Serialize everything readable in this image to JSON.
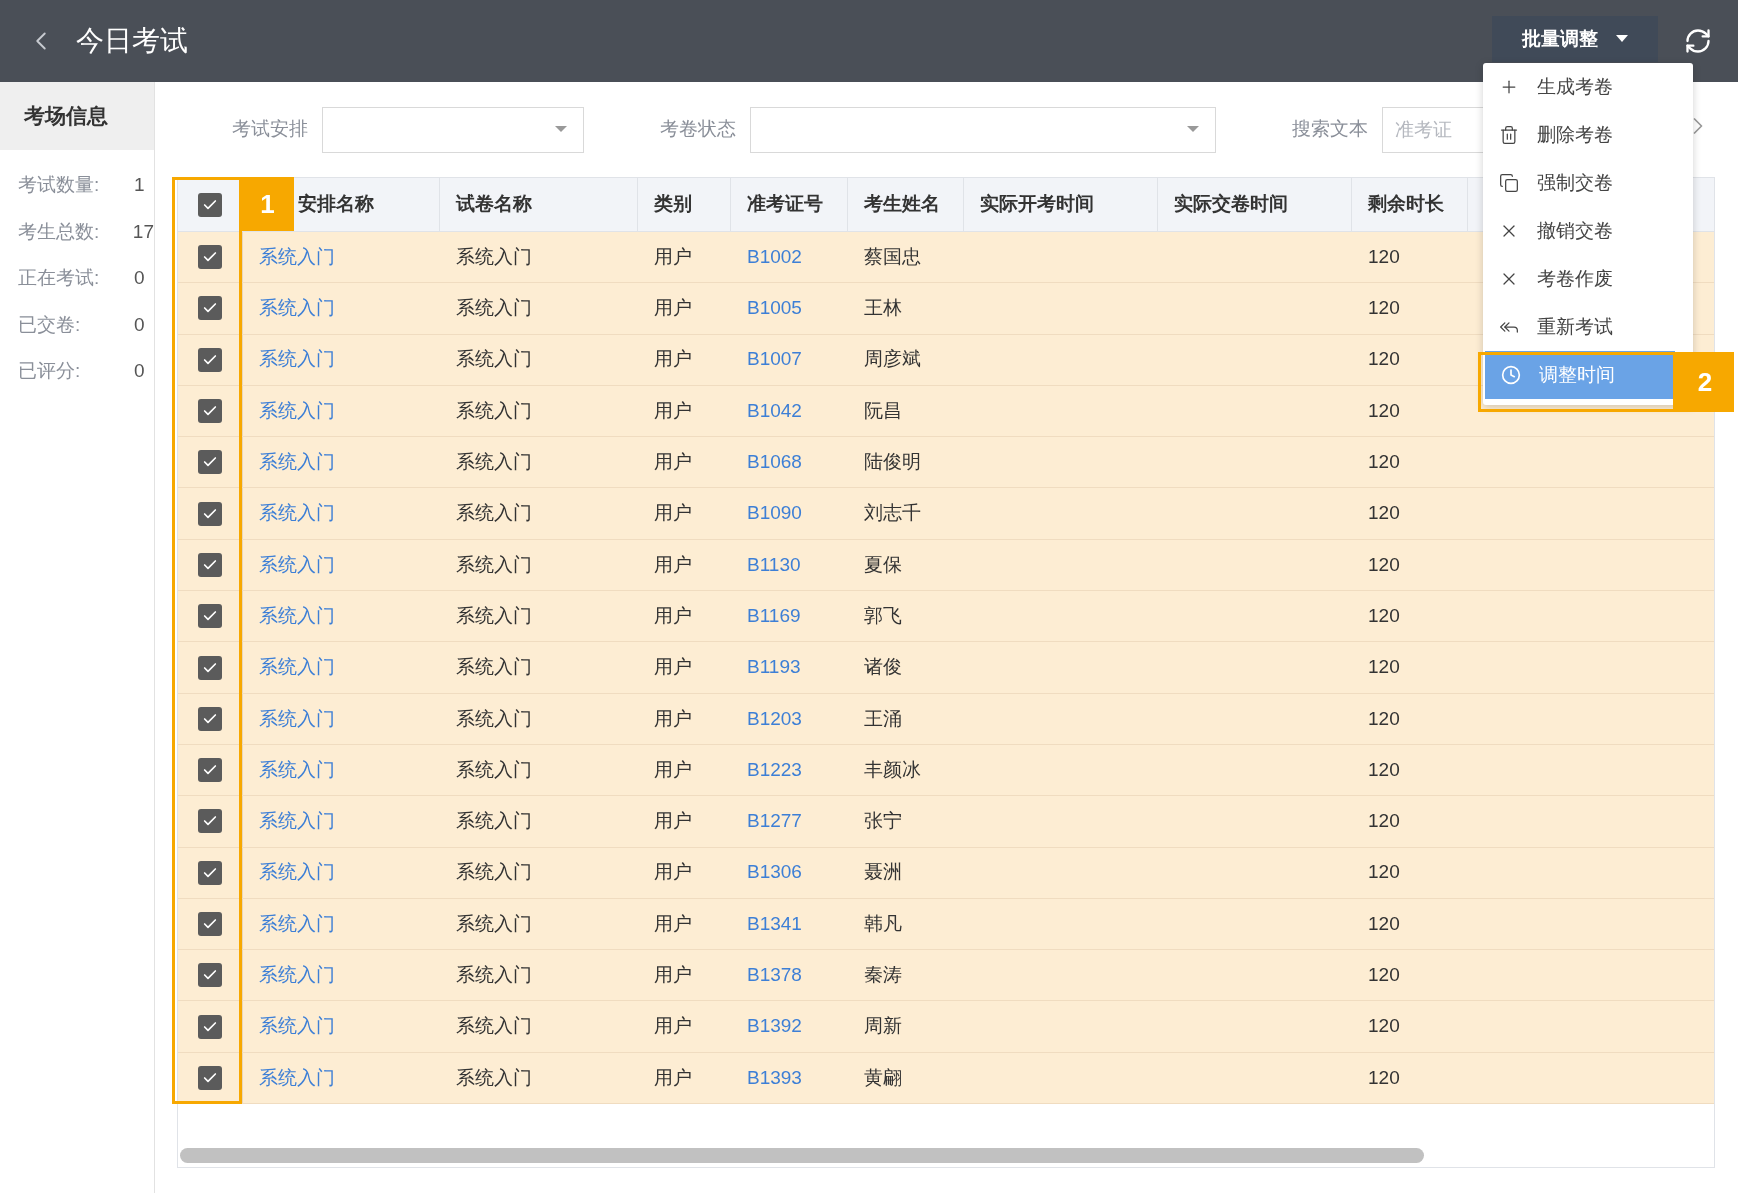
{
  "header": {
    "title": "今日考试",
    "batch_button": "批量调整"
  },
  "sidebar": {
    "title": "考场信息",
    "stats": [
      {
        "label": "考试数量:",
        "value": "1"
      },
      {
        "label": "考生总数:",
        "value": "17"
      },
      {
        "label": "正在考试:",
        "value": "0"
      },
      {
        "label": "已交卷:",
        "value": "0"
      },
      {
        "label": "已评分:",
        "value": "0"
      }
    ]
  },
  "filters": [
    {
      "kind": "select",
      "label": "考试安排"
    },
    {
      "kind": "select",
      "label": "考卷状态"
    },
    {
      "kind": "text",
      "label": "搜索文本",
      "placeholder": "准考证"
    }
  ],
  "table": {
    "select_all_checked": true,
    "columns": [
      "安排名称",
      "试卷名称",
      "类别",
      "准考证号",
      "考生姓名",
      "实际开考时间",
      "实际交卷时间",
      "剩余时长"
    ],
    "rows": [
      {
        "checked": true,
        "arrangement": "系统入门",
        "paper": "系统入门",
        "category": "用户",
        "ticket": "B1002",
        "name": "蔡国忠",
        "remaining": "120"
      },
      {
        "checked": true,
        "arrangement": "系统入门",
        "paper": "系统入门",
        "category": "用户",
        "ticket": "B1005",
        "name": "王林",
        "remaining": "120"
      },
      {
        "checked": true,
        "arrangement": "系统入门",
        "paper": "系统入门",
        "category": "用户",
        "ticket": "B1007",
        "name": "周彦斌",
        "remaining": "120"
      },
      {
        "checked": true,
        "arrangement": "系统入门",
        "paper": "系统入门",
        "category": "用户",
        "ticket": "B1042",
        "name": "阮昌",
        "remaining": "120"
      },
      {
        "checked": true,
        "arrangement": "系统入门",
        "paper": "系统入门",
        "category": "用户",
        "ticket": "B1068",
        "name": "陆俊明",
        "remaining": "120"
      },
      {
        "checked": true,
        "arrangement": "系统入门",
        "paper": "系统入门",
        "category": "用户",
        "ticket": "B1090",
        "name": "刘志千",
        "remaining": "120"
      },
      {
        "checked": true,
        "arrangement": "系统入门",
        "paper": "系统入门",
        "category": "用户",
        "ticket": "B1130",
        "name": "夏保",
        "remaining": "120"
      },
      {
        "checked": true,
        "arrangement": "系统入门",
        "paper": "系统入门",
        "category": "用户",
        "ticket": "B1169",
        "name": "郭飞",
        "remaining": "120"
      },
      {
        "checked": true,
        "arrangement": "系统入门",
        "paper": "系统入门",
        "category": "用户",
        "ticket": "B1193",
        "name": "诸俊",
        "remaining": "120"
      },
      {
        "checked": true,
        "arrangement": "系统入门",
        "paper": "系统入门",
        "category": "用户",
        "ticket": "B1203",
        "name": "王涌",
        "remaining": "120"
      },
      {
        "checked": true,
        "arrangement": "系统入门",
        "paper": "系统入门",
        "category": "用户",
        "ticket": "B1223",
        "name": "丰颜冰",
        "remaining": "120"
      },
      {
        "checked": true,
        "arrangement": "系统入门",
        "paper": "系统入门",
        "category": "用户",
        "ticket": "B1277",
        "name": "张宁",
        "remaining": "120"
      },
      {
        "checked": true,
        "arrangement": "系统入门",
        "paper": "系统入门",
        "category": "用户",
        "ticket": "B1306",
        "name": "聂洲",
        "remaining": "120"
      },
      {
        "checked": true,
        "arrangement": "系统入门",
        "paper": "系统入门",
        "category": "用户",
        "ticket": "B1341",
        "name": "韩凡",
        "remaining": "120"
      },
      {
        "checked": true,
        "arrangement": "系统入门",
        "paper": "系统入门",
        "category": "用户",
        "ticket": "B1378",
        "name": "秦涛",
        "remaining": "120"
      },
      {
        "checked": true,
        "arrangement": "系统入门",
        "paper": "系统入门",
        "category": "用户",
        "ticket": "B1392",
        "name": "周新",
        "remaining": "120"
      },
      {
        "checked": true,
        "arrangement": "系统入门",
        "paper": "系统入门",
        "category": "用户",
        "ticket": "B1393",
        "name": "黄翩",
        "remaining": "120"
      }
    ]
  },
  "menu": {
    "items": [
      {
        "kind": "add",
        "label": "生成考卷",
        "selected": false
      },
      {
        "kind": "delete",
        "label": "删除考卷",
        "selected": false
      },
      {
        "kind": "copy",
        "label": "强制交卷",
        "selected": false
      },
      {
        "kind": "cancel",
        "label": "撤销交卷",
        "selected": false
      },
      {
        "kind": "cancel",
        "label": "考卷作废",
        "selected": false
      },
      {
        "kind": "redo",
        "label": "重新考试",
        "selected": false
      },
      {
        "kind": "time",
        "label": "调整时间",
        "selected": true
      }
    ]
  },
  "callouts": [
    "1",
    "2"
  ]
}
